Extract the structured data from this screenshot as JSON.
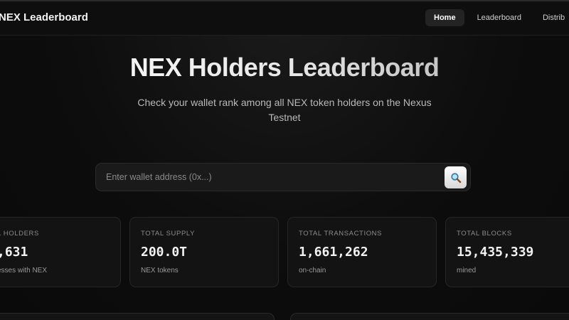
{
  "nav": {
    "brand": "NEX Leaderboard",
    "links": [
      "Home",
      "Leaderboard",
      "Distrib"
    ]
  },
  "hero": {
    "title": "NEX Holders Leaderboard",
    "subtitle": "Check your wallet rank among all NEX token holders on the Nexus Testnet"
  },
  "search": {
    "placeholder": "Enter wallet address (0x...)",
    "value": "",
    "button_icon": "search-icon"
  },
  "stats": [
    {
      "label": "L HOLDERS",
      "value": ",631",
      "sub": "esses with NEX"
    },
    {
      "label": "TOTAL SUPPLY",
      "value": "200.0T",
      "sub": "NEX tokens"
    },
    {
      "label": "TOTAL TRANSACTIONS",
      "value": "1,661,262",
      "sub": "on-chain"
    },
    {
      "label": "TOTAL BLOCKS",
      "value": "15,435,339",
      "sub": "mined"
    }
  ],
  "colors": {
    "background": "#0b0b0b",
    "card": "#131313",
    "accent_button": "#e6e6e6"
  }
}
